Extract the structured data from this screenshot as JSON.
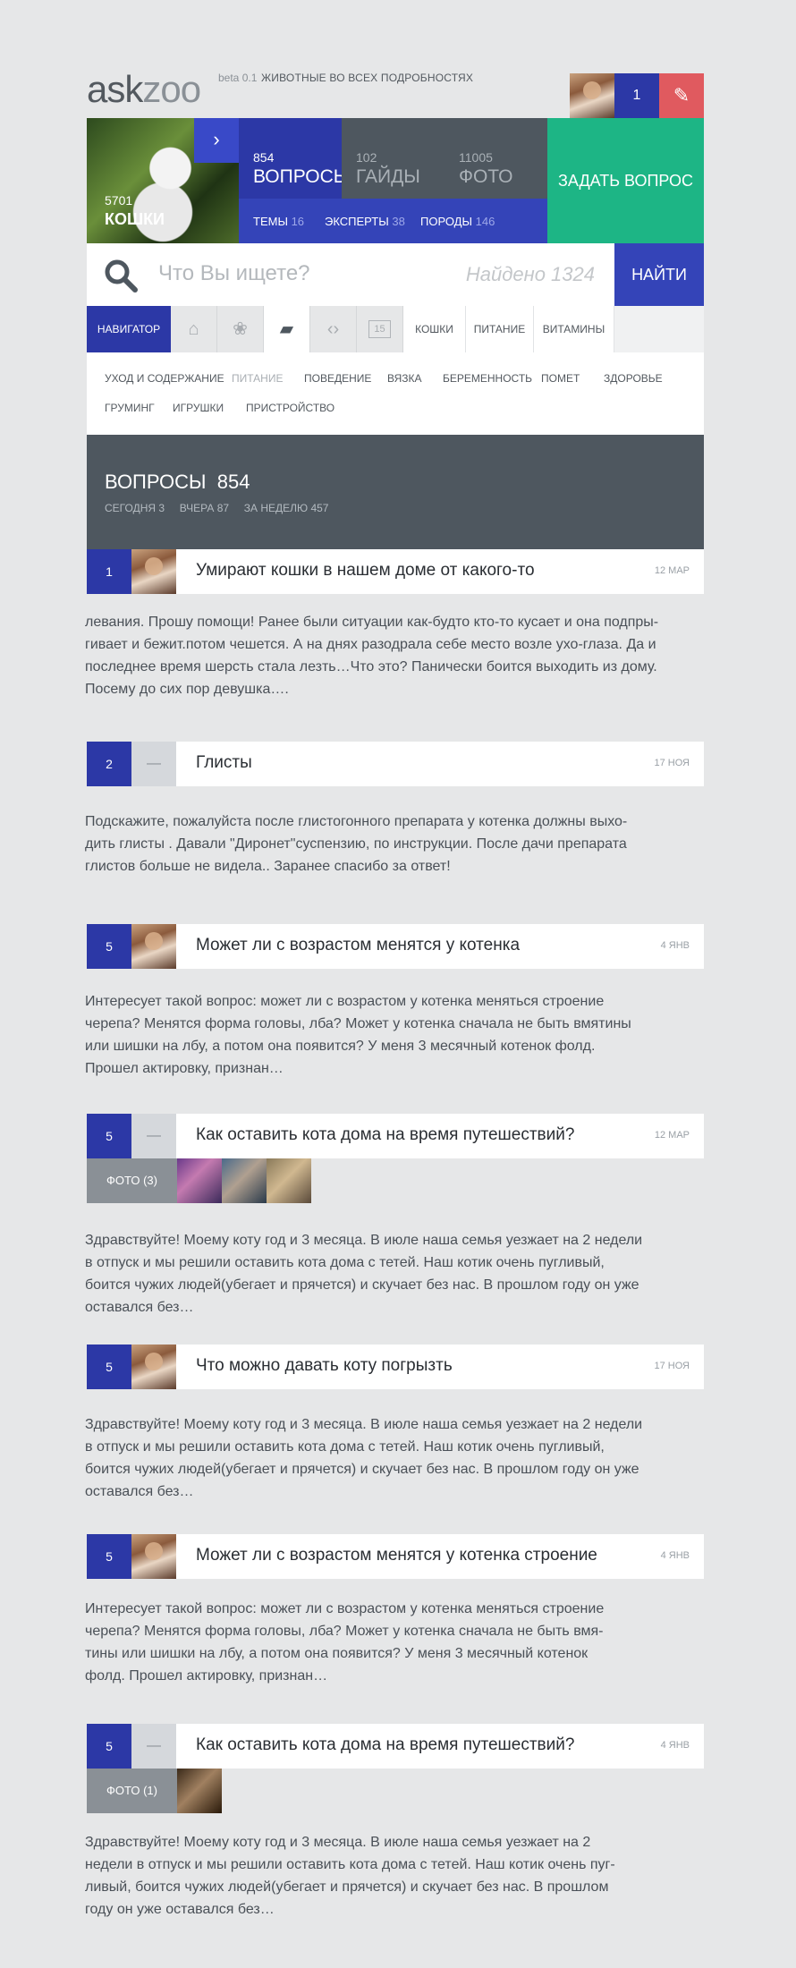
{
  "header": {
    "logo_a": "ask",
    "logo_b": "zoo",
    "beta": "beta 0.1",
    "tagline": "ЖИВОТНЫЕ ВО ВСЕХ ПОДРОБНОСТЯХ",
    "notifications": "1"
  },
  "hero": {
    "cat_count": "5701",
    "cat_label": "КОШКИ",
    "tiles": [
      {
        "count": "854",
        "label": "ВОПРОСЫ"
      },
      {
        "count": "102",
        "label": "ГАЙДЫ"
      },
      {
        "count": "11005",
        "label": "ФОТО"
      }
    ],
    "sub": [
      {
        "label": "ТЕМЫ",
        "count": "16"
      },
      {
        "label": "ЭКСПЕРТЫ",
        "count": "38"
      },
      {
        "label": "ПОРОДЫ",
        "count": "146"
      }
    ],
    "ask_button": "ЗАДАТЬ ВОПРОС"
  },
  "search": {
    "placeholder": "Что Вы ищете?",
    "found": "Найдено 1324",
    "button": "НАЙТИ"
  },
  "nav": {
    "navigator": "НАВИГАТОР",
    "calendar_day": "15",
    "tabs": [
      "КОШКИ",
      "ПИТАНИЕ",
      "ВИТАМИНЫ"
    ]
  },
  "categories": [
    "УХОД И СОДЕРЖАНИЕ",
    "ПИТАНИЕ",
    "ПОВЕДЕНИЕ",
    "ВЯЗКА",
    "БЕРЕМЕННОСТЬ",
    "ПОМЕТ",
    "ЗДОРОВЬЕ",
    "ГРУМИНГ",
    "ИГРУШКИ",
    "ПРИСТРОЙСТВО"
  ],
  "section": {
    "title": "ВОПРОСЫ",
    "count": "854",
    "today": "СЕГОДНЯ 3",
    "yesterday": "ВЧЕРА 87",
    "week": "ЗА НЕДЕЛЮ 457"
  },
  "questions": [
    {
      "num": "1",
      "title": "Умирают кошки в нашем доме от какого-то",
      "date": "12 МАР",
      "lines": [
        "левания. Прошу помощи! Ранее были ситуации как-будто кто-то кусает и она подпры-",
        "гивает и бежит.потом чешется. А на днях разодрала себе место возле ухо-глаза. Да и",
        "последнее время шерсть стала лезть…Что это? Панически боится выходить из дому.",
        "Посему до сих пор девушка…."
      ]
    },
    {
      "num": "2",
      "title": "Глисты",
      "date": "17 НОЯ",
      "lines": [
        "Подскажите, пожалуйста после глистогонного препарата у котенка должны выхо-",
        "дить глисты . Давали \"Диронет\"суспензию, по инструкции. После дачи препарата",
        "глистов больше не видела.. Заранее спасибо за ответ!"
      ]
    },
    {
      "num": "5",
      "title": "Может ли с возрастом менятся у котенка",
      "date": "4 ЯНВ",
      "lines": [
        "Интересует такой вопрос: может ли с возрастом у котенка меняться строение",
        "черепа? Менятся форма головы, лба? Может у котенка сначала не быть вмятины",
        "или шишки на лбу, а потом она появится? У меня 3 месячный котенок фолд.",
        "Прошел актировку, признан…"
      ]
    },
    {
      "num": "5",
      "title": "Как оставить кота дома на время путешествий?",
      "date": "12 МАР",
      "photos": "ФОТО (3)",
      "lines": [
        "Здравствуйте! Моему коту год и 3 месяца. В июле наша семья уезжает на 2 недели",
        "в отпуск и мы решили оставить кота дома с тетей. Наш котик очень пугливый,",
        "боится чужих людей(убегает и прячется) и скучает без нас. В прошлом году он уже",
        "оставался без…"
      ]
    },
    {
      "num": "5",
      "title": "Что можно давать коту погрызть",
      "date": "17 НОЯ",
      "lines": [
        "Здравствуйте! Моему коту год и 3 месяца. В июле наша семья уезжает на 2 недели",
        "в отпуск и мы решили оставить кота дома с тетей. Наш котик очень пугливый,",
        "боится чужих людей(убегает и прячется) и скучает без нас. В прошлом году он уже",
        "оставался без…"
      ]
    },
    {
      "num": "5",
      "title": "Может ли с возрастом менятся у котенка строение",
      "date": "4 ЯНВ",
      "lines": [
        "Интересует такой вопрос: может ли с возрастом у котенка меняться строение",
        "черепа? Менятся форма головы, лба? Может у котенка сначала не быть вмя-",
        "тины или шишки на лбу, а потом она появится? У меня 3 месячный котенок",
        "фолд. Прошел актировку, признан…"
      ]
    },
    {
      "num": "5",
      "title": "Как оставить кота дома на время путешествий?",
      "date": "4 ЯНВ",
      "photos": "ФОТО (1)",
      "lines": [
        "Здравствуйте! Моему коту год и 3 месяца. В июле наша семья уезжает на 2",
        "недели в отпуск и мы решили оставить кота дома с тетей. Наш котик очень пуг-",
        "ливый, боится чужих людей(убегает и прячется) и скучает без нас. В прошлом",
        "году он уже оставался без…"
      ]
    }
  ]
}
